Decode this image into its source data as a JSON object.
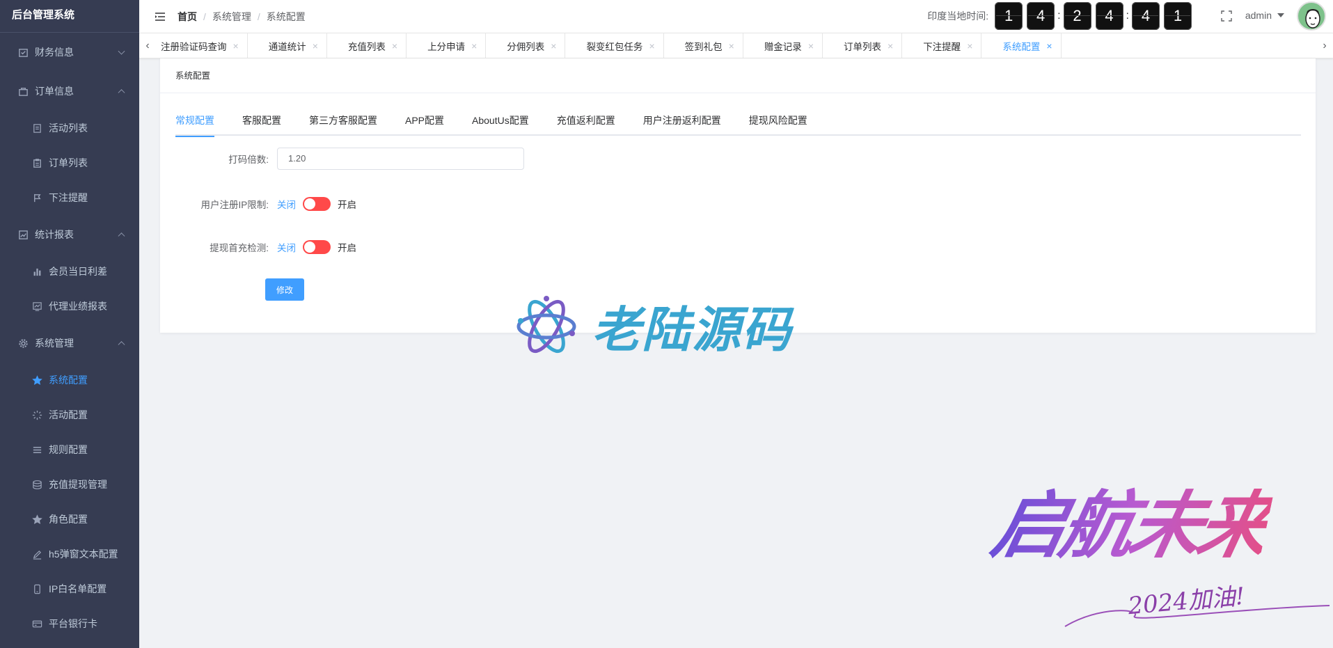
{
  "app": {
    "title": "后台管理系统"
  },
  "sidebar": {
    "groups": [
      {
        "label": "财务信息",
        "icon": "wallet-icon",
        "expanded": false
      },
      {
        "label": "订单信息",
        "icon": "bag-icon",
        "expanded": true,
        "items": [
          {
            "label": "活动列表",
            "icon": "document-icon"
          },
          {
            "label": "订单列表",
            "icon": "clipboard-icon"
          },
          {
            "label": "下注提醒",
            "icon": "flag-icon"
          }
        ]
      },
      {
        "label": "统计报表",
        "icon": "chart-icon",
        "expanded": true,
        "items": [
          {
            "label": "会员当日利差",
            "icon": "bar-chart-icon"
          },
          {
            "label": "代理业绩报表",
            "icon": "trend-icon"
          }
        ]
      },
      {
        "label": "系统管理",
        "icon": "gear-icon",
        "expanded": true,
        "items": [
          {
            "label": "系统配置",
            "icon": "star-icon",
            "active": true
          },
          {
            "label": "活动配置",
            "icon": "loading-icon"
          },
          {
            "label": "规则配置",
            "icon": "list-icon"
          },
          {
            "label": "充值提现管理",
            "icon": "coins-icon"
          },
          {
            "label": "角色配置",
            "icon": "star-icon"
          },
          {
            "label": "h5弹窗文本配置",
            "icon": "edit-icon"
          },
          {
            "label": "IP白名单配置",
            "icon": "phone-icon"
          },
          {
            "label": "平台银行卡",
            "icon": "card-icon"
          }
        ]
      }
    ]
  },
  "header": {
    "breadcrumb": [
      "首页",
      "系统管理",
      "系统配置"
    ],
    "clock_label": "印度当地时间:",
    "clock_digits": [
      "1",
      "4",
      "2",
      "4",
      "4",
      "1"
    ],
    "clock_sep": ":",
    "user": "admin"
  },
  "tags": {
    "left_arrow": "‹",
    "right_arrow": "›",
    "close": "×",
    "items": [
      "注册验证码查询",
      "通道统计",
      "充值列表",
      "上分申请",
      "分佣列表",
      "裂变红包任务",
      "签到礼包",
      "赠金记录",
      "订单列表",
      "下注提醒",
      "系统配置"
    ],
    "active_index": 10
  },
  "card": {
    "title": "系统配置",
    "tabs": [
      "常规配置",
      "客服配置",
      "第三方客服配置",
      "APP配置",
      "AboutUs配置",
      "充值返利配置",
      "用户注册返利配置",
      "提现风险配置"
    ],
    "active_tab": 0,
    "form": {
      "bet_multiplier_label": "打码倍数:",
      "bet_multiplier_value": "1.20",
      "ip_limit_label": "用户注册IP限制:",
      "withdraw_check_label": "提现首充检测:",
      "switch_off": "关闭",
      "switch_on": "开启",
      "submit": "修改"
    }
  },
  "watermark": {
    "brand": "老陆源码",
    "slogan": "启航未来",
    "sub": "2024加油!"
  },
  "colors": {
    "sidebar_bg": "#363c52",
    "accent": "#409eff",
    "switch_off": "#ff4949"
  }
}
